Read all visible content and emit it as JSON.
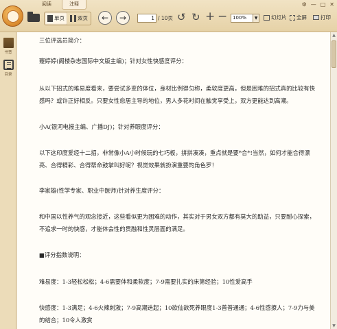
{
  "tabs": [
    {
      "label": "阅读"
    },
    {
      "label": "注释"
    }
  ],
  "window_controls": {
    "settings": "⚙",
    "minimize": "—",
    "maximize": "□",
    "close": "✕"
  },
  "toolbar": {
    "view_single": "单页",
    "view_double": "双页",
    "page_current": "1",
    "page_total": "/ 10页",
    "zoom_value": "100%",
    "slideshow": "幻灯片",
    "fullscreen": "全屏",
    "print": "打印"
  },
  "sidebar": {
    "items": [
      {
        "label": "书签",
        "icon": "cover-thumbnail-icon"
      },
      {
        "label": "目录",
        "icon": "toc-icon"
      }
    ]
  },
  "content": {
    "paragraphs": [
      "三位评选员简介：",
      "蹇婷婷(阁楼杂志国际中文版主编)；针对女性快感度评分：",
      "从以下招式的难易度看来，要尝试多变的体位，身材比例得匀称，柔软度更高，但是困难的招式真的比较有快感吗？或许正好相反。只要女性愈居主导的地位，男人多花时间在触觉享受上，双方更能达到高潮。",
      "小A(银河电报主编、广播DJ)；针对养眼度评分：",
      "以下这印度爱经十二招，非常像小A小时候玩的七巧板，拼拼凑凑，重点就是要*合*!当然，如何才能合得漂亮、合得精彩、合得帮命鼓掌叫好呢？视觉效果就扮演重要的角色罗！",
      "李家雄(性学专家、职业中医师)针对养生度评分：",
      "和中国以性养气的观念接近，这些看似更为困难的动作，其实对于男女双方都有莫大的助益，只要耐心探索，不追求一时的快感，才能体会性的贯融和性灵层面的满足。",
      "■评分指数说明：",
      "难易度：1-3轻松松松；4-6需要体和柔软度；7-9需要扎实的床第经验；10性爱高手",
      "快感度：1-3满足；4-6火辣刺激；7-9高潮迭起；10欲仙欲死养眼度1-3普普通通；4-6性感撩人；7-9力与美的结合；10令人激赏"
    ]
  },
  "colors": {
    "toolbar_bg": "#e9d7b0",
    "sidebar_bg": "#ecdcb9",
    "page_bg": "#fffdf8",
    "accent": "#d98a2c"
  }
}
